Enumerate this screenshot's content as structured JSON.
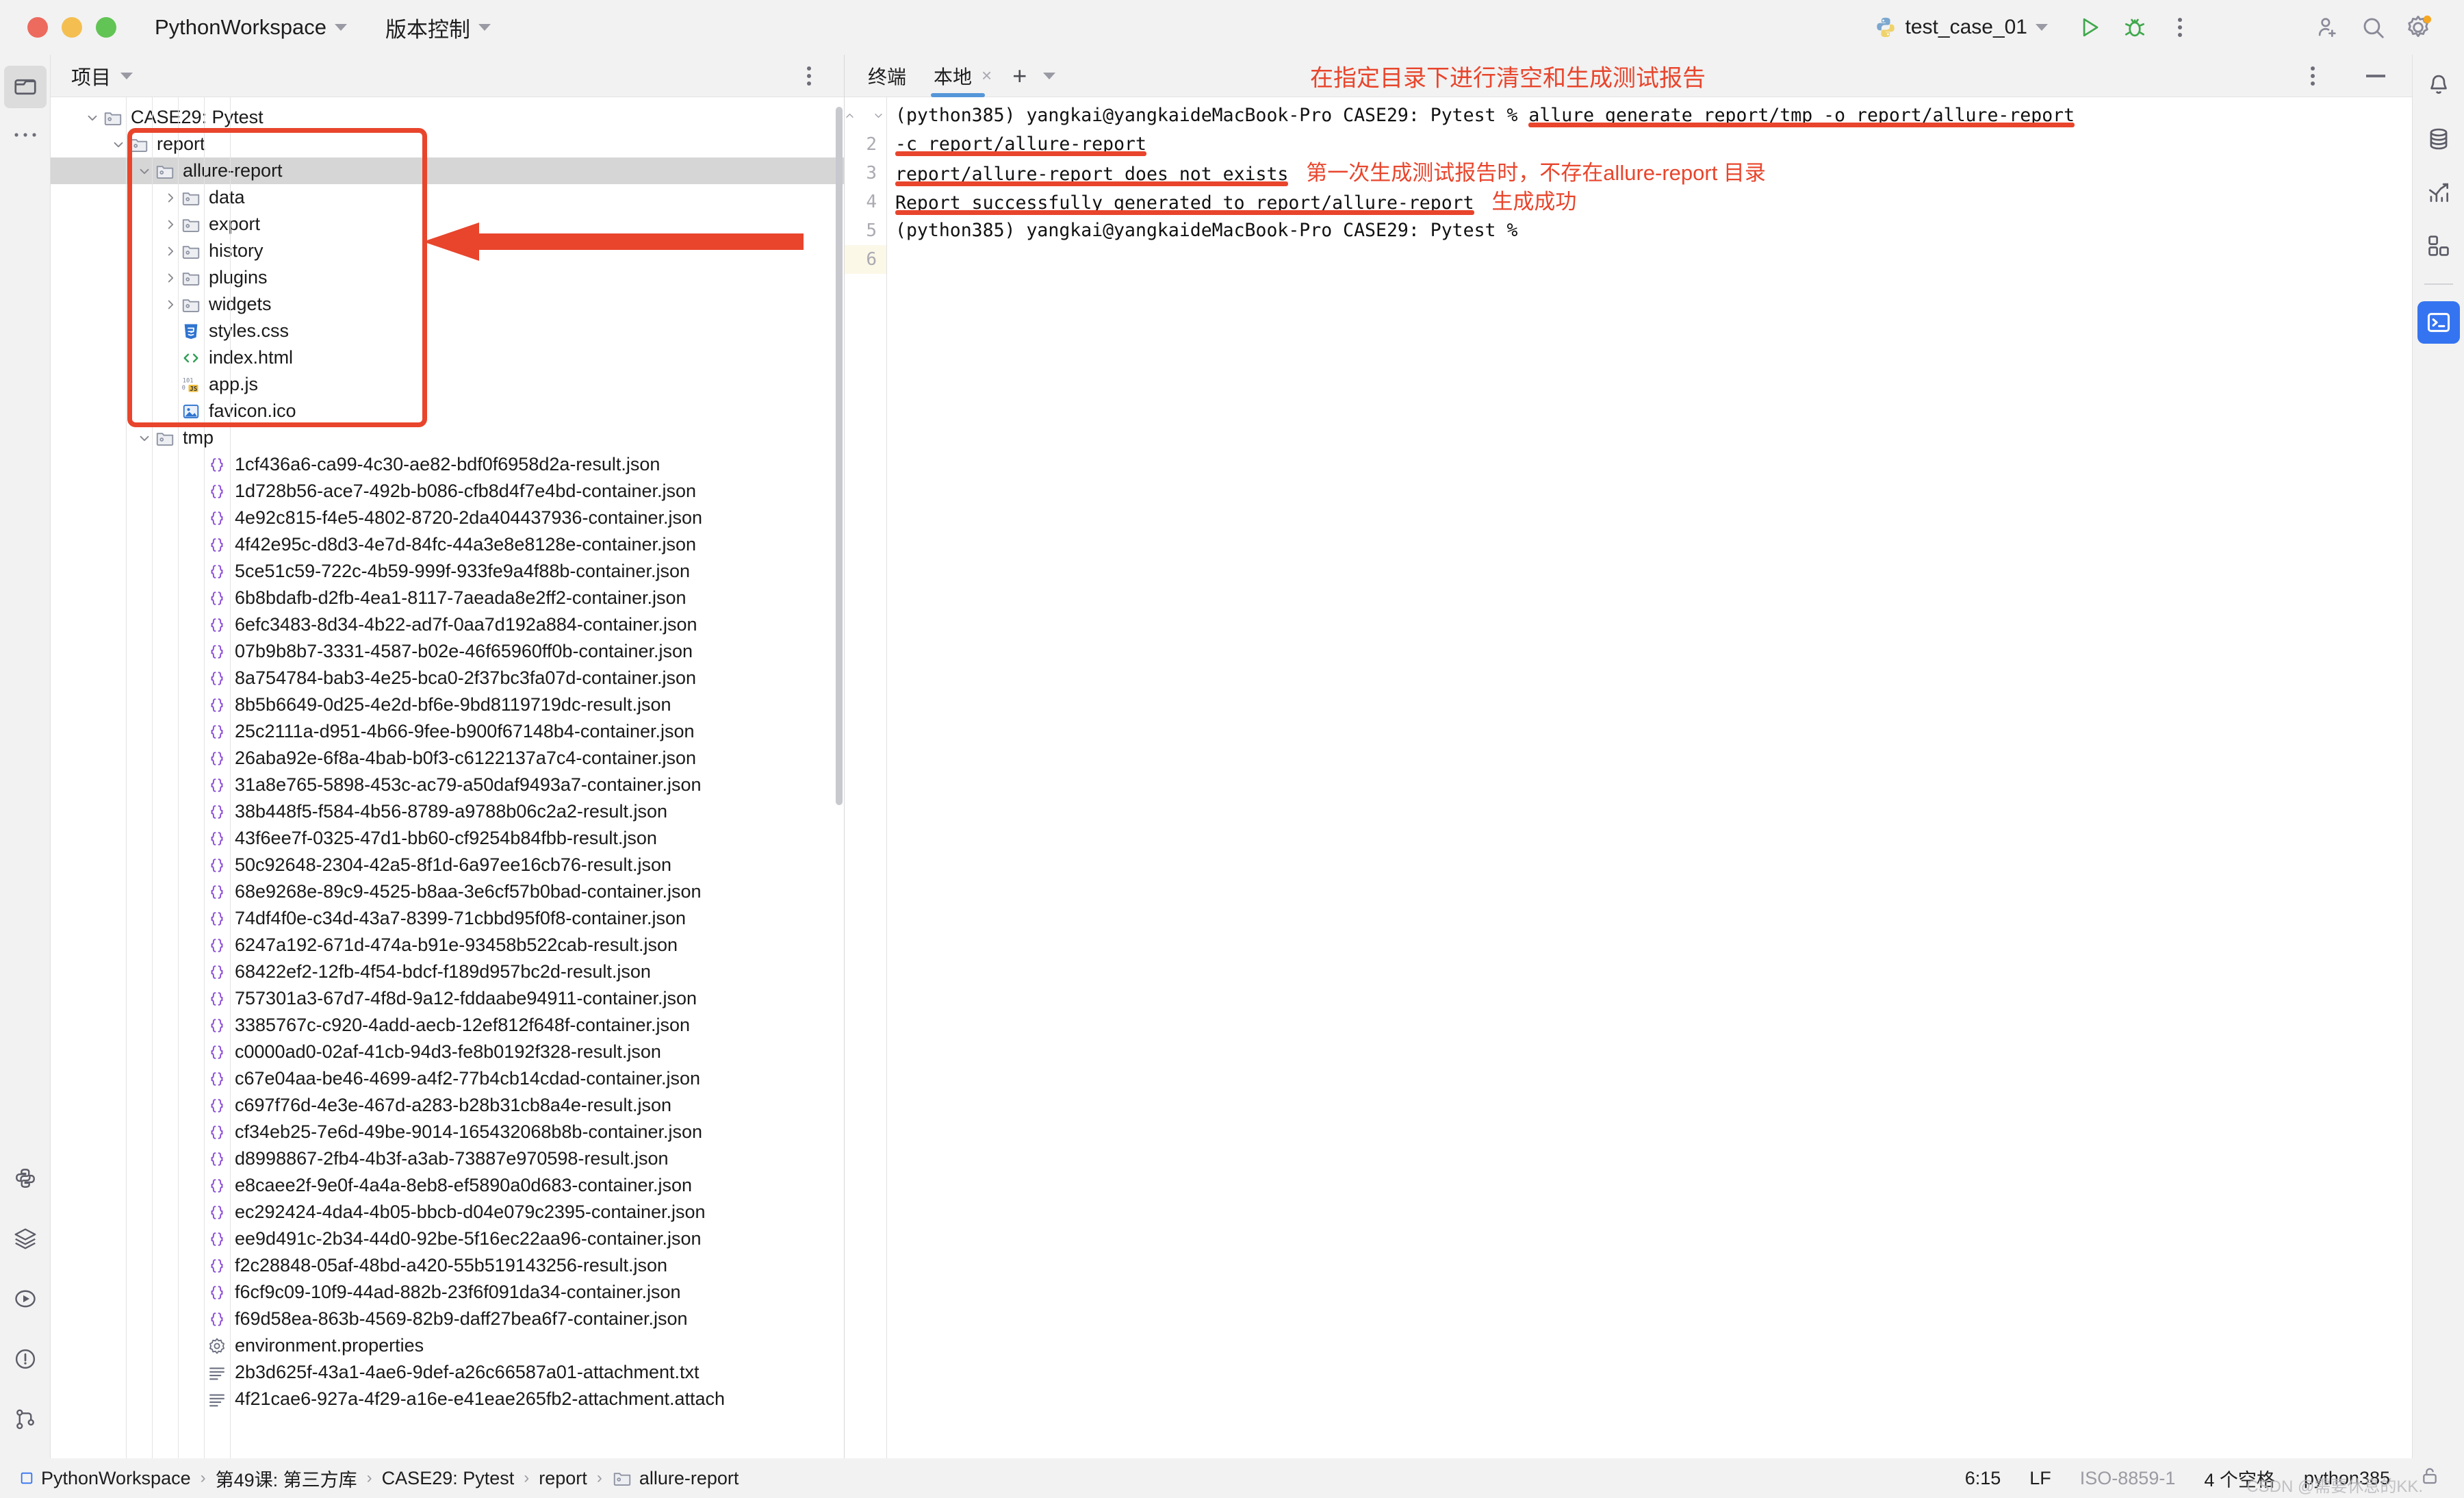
{
  "window": {
    "project_name": "PythonWorkspace",
    "vcs_label": "版本控制",
    "run_config": "test_case_01"
  },
  "project_panel": {
    "title": "项目",
    "tree": [
      {
        "label": "CASE29: Pytest",
        "indent": 0,
        "icon": "folder-module",
        "state": "expanded",
        "selected": false
      },
      {
        "label": "report",
        "indent": 1,
        "icon": "folder-module",
        "state": "expanded",
        "selected": false
      },
      {
        "label": "allure-report",
        "indent": 2,
        "icon": "folder-module",
        "state": "expanded",
        "selected": true
      },
      {
        "label": "data",
        "indent": 3,
        "icon": "folder-module",
        "state": "collapsed",
        "selected": false
      },
      {
        "label": "export",
        "indent": 3,
        "icon": "folder-module",
        "state": "collapsed",
        "selected": false
      },
      {
        "label": "history",
        "indent": 3,
        "icon": "folder-module",
        "state": "collapsed",
        "selected": false
      },
      {
        "label": "plugins",
        "indent": 3,
        "icon": "folder-module",
        "state": "collapsed",
        "selected": false
      },
      {
        "label": "widgets",
        "indent": 3,
        "icon": "folder-module",
        "state": "collapsed",
        "selected": false
      },
      {
        "label": "styles.css",
        "indent": 3,
        "icon": "css-icon",
        "state": "leaf",
        "selected": false
      },
      {
        "label": "index.html",
        "indent": 3,
        "icon": "html-icon",
        "state": "leaf",
        "selected": false
      },
      {
        "label": "app.js",
        "indent": 3,
        "icon": "js-icon",
        "state": "leaf",
        "selected": false
      },
      {
        "label": "favicon.ico",
        "indent": 3,
        "icon": "image-icon",
        "state": "leaf",
        "selected": false
      },
      {
        "label": "tmp",
        "indent": 2,
        "icon": "folder-module",
        "state": "expanded",
        "selected": false
      },
      {
        "label": "1cf436a6-ca99-4c30-ae82-bdf0f6958d2a-result.json",
        "indent": 4,
        "icon": "json-icon",
        "state": "leaf",
        "selected": false
      },
      {
        "label": "1d728b56-ace7-492b-b086-cfb8d4f7e4bd-container.json",
        "indent": 4,
        "icon": "json-icon",
        "state": "leaf",
        "selected": false
      },
      {
        "label": "4e92c815-f4e5-4802-8720-2da404437936-container.json",
        "indent": 4,
        "icon": "json-icon",
        "state": "leaf",
        "selected": false
      },
      {
        "label": "4f42e95c-d8d3-4e7d-84fc-44a3e8e8128e-container.json",
        "indent": 4,
        "icon": "json-icon",
        "state": "leaf",
        "selected": false
      },
      {
        "label": "5ce51c59-722c-4b59-999f-933fe9a4f88b-container.json",
        "indent": 4,
        "icon": "json-icon",
        "state": "leaf",
        "selected": false
      },
      {
        "label": "6b8bdafb-d2fb-4ea1-8117-7aeada8e2ff2-container.json",
        "indent": 4,
        "icon": "json-icon",
        "state": "leaf",
        "selected": false
      },
      {
        "label": "6efc3483-8d34-4b22-ad7f-0aa7d192a884-container.json",
        "indent": 4,
        "icon": "json-icon",
        "state": "leaf",
        "selected": false
      },
      {
        "label": "07b9b8b7-3331-4587-b02e-46f65960ff0b-container.json",
        "indent": 4,
        "icon": "json-icon",
        "state": "leaf",
        "selected": false
      },
      {
        "label": "8a754784-bab3-4e25-bca0-2f37bc3fa07d-container.json",
        "indent": 4,
        "icon": "json-icon",
        "state": "leaf",
        "selected": false
      },
      {
        "label": "8b5b6649-0d25-4e2d-bf6e-9bd8119719dc-result.json",
        "indent": 4,
        "icon": "json-icon",
        "state": "leaf",
        "selected": false
      },
      {
        "label": "25c2111a-d951-4b66-9fee-b900f67148b4-container.json",
        "indent": 4,
        "icon": "json-icon",
        "state": "leaf",
        "selected": false
      },
      {
        "label": "26aba92e-6f8a-4bab-b0f3-c6122137a7c4-container.json",
        "indent": 4,
        "icon": "json-icon",
        "state": "leaf",
        "selected": false
      },
      {
        "label": "31a8e765-5898-453c-ac79-a50daf9493a7-container.json",
        "indent": 4,
        "icon": "json-icon",
        "state": "leaf",
        "selected": false
      },
      {
        "label": "38b448f5-f584-4b56-8789-a9788b06c2a2-result.json",
        "indent": 4,
        "icon": "json-icon",
        "state": "leaf",
        "selected": false
      },
      {
        "label": "43f6ee7f-0325-47d1-bb60-cf9254b84fbb-result.json",
        "indent": 4,
        "icon": "json-icon",
        "state": "leaf",
        "selected": false
      },
      {
        "label": "50c92648-2304-42a5-8f1d-6a97ee16cb76-result.json",
        "indent": 4,
        "icon": "json-icon",
        "state": "leaf",
        "selected": false
      },
      {
        "label": "68e9268e-89c9-4525-b8aa-3e6cf57b0bad-container.json",
        "indent": 4,
        "icon": "json-icon",
        "state": "leaf",
        "selected": false
      },
      {
        "label": "74df4f0e-c34d-43a7-8399-71cbbd95f0f8-container.json",
        "indent": 4,
        "icon": "json-icon",
        "state": "leaf",
        "selected": false
      },
      {
        "label": "6247a192-671d-474a-b91e-93458b522cab-result.json",
        "indent": 4,
        "icon": "json-icon",
        "state": "leaf",
        "selected": false
      },
      {
        "label": "68422ef2-12fb-4f54-bdcf-f189d957bc2d-result.json",
        "indent": 4,
        "icon": "json-icon",
        "state": "leaf",
        "selected": false
      },
      {
        "label": "757301a3-67d7-4f8d-9a12-fddaabe94911-container.json",
        "indent": 4,
        "icon": "json-icon",
        "state": "leaf",
        "selected": false
      },
      {
        "label": "3385767c-c920-4add-aecb-12ef812f648f-container.json",
        "indent": 4,
        "icon": "json-icon",
        "state": "leaf",
        "selected": false
      },
      {
        "label": "c0000ad0-02af-41cb-94d3-fe8b0192f328-result.json",
        "indent": 4,
        "icon": "json-icon",
        "state": "leaf",
        "selected": false
      },
      {
        "label": "c67e04aa-be46-4699-a4f2-77b4cb14cdad-container.json",
        "indent": 4,
        "icon": "json-icon",
        "state": "leaf",
        "selected": false
      },
      {
        "label": "c697f76d-4e3e-467d-a283-b28b31cb8a4e-result.json",
        "indent": 4,
        "icon": "json-icon",
        "state": "leaf",
        "selected": false
      },
      {
        "label": "cf34eb25-7e6d-49be-9014-165432068b8b-container.json",
        "indent": 4,
        "icon": "json-icon",
        "state": "leaf",
        "selected": false
      },
      {
        "label": "d8998867-2fb4-4b3f-a3ab-73887e970598-result.json",
        "indent": 4,
        "icon": "json-icon",
        "state": "leaf",
        "selected": false
      },
      {
        "label": "e8caee2f-9e0f-4a4a-8eb8-ef5890a0d683-container.json",
        "indent": 4,
        "icon": "json-icon",
        "state": "leaf",
        "selected": false
      },
      {
        "label": "ec292424-4da4-4b05-bbcb-d04e079c2395-container.json",
        "indent": 4,
        "icon": "json-icon",
        "state": "leaf",
        "selected": false
      },
      {
        "label": "ee9d491c-2b34-44d0-92be-5f16ec22aa96-container.json",
        "indent": 4,
        "icon": "json-icon",
        "state": "leaf",
        "selected": false
      },
      {
        "label": "f2c28848-05af-48bd-a420-55b519143256-result.json",
        "indent": 4,
        "icon": "json-icon",
        "state": "leaf",
        "selected": false
      },
      {
        "label": "f6cf9c09-10f9-44ad-882b-23f6f091da34-container.json",
        "indent": 4,
        "icon": "json-icon",
        "state": "leaf",
        "selected": false
      },
      {
        "label": "f69d58ea-863b-4569-82b9-daff27bea6f7-container.json",
        "indent": 4,
        "icon": "json-icon",
        "state": "leaf",
        "selected": false
      },
      {
        "label": "environment.properties",
        "indent": 4,
        "icon": "properties-icon",
        "state": "leaf",
        "selected": false
      },
      {
        "label": "2b3d625f-43a1-4ae6-9def-a26c66587a01-attachment.txt",
        "indent": 4,
        "icon": "text-icon",
        "state": "leaf",
        "selected": false
      },
      {
        "label": "4f21cae6-927a-4f29-a16e-e41eae265fb2-attachment.attach",
        "indent": 4,
        "icon": "text-icon",
        "state": "leaf",
        "selected": false
      }
    ]
  },
  "terminal": {
    "label": "终端",
    "tab": "本地",
    "close_label": "×",
    "plus_label": "+",
    "annotation_top": "在指定目录下进行清空和生成测试报告",
    "line_numbers": [
      "2",
      "3",
      "4",
      "5",
      "6"
    ],
    "lines": [
      {
        "segments": [
          {
            "text": "(python385) yangkai@yangkaideMacBook-Pro CASE29: Pytest % ",
            "underline": false,
            "style": "mono"
          },
          {
            "text": "allure generate report/tmp -o report/allure-report",
            "underline": true,
            "style": "mono"
          }
        ]
      },
      {
        "segments": [
          {
            "text": "-c report/allure-report",
            "underline": true,
            "style": "mono"
          }
        ]
      },
      {
        "segments": [
          {
            "text": "report/allure-report does not exists",
            "underline": true,
            "style": "mono"
          },
          {
            "text": "   第一次生成测试报告时，不存在allure-report 目录",
            "underline": false,
            "style": "cn"
          }
        ]
      },
      {
        "segments": [
          {
            "text": "Report successfully generated to report/allure-report",
            "underline": true,
            "style": "mono"
          },
          {
            "text": "   生成成功",
            "underline": false,
            "style": "cn"
          }
        ]
      },
      {
        "segments": [
          {
            "text": "(python385) yangkai@yangkaideMacBook-Pro CASE29: Pytest %",
            "underline": false,
            "style": "mono"
          }
        ]
      }
    ]
  },
  "status_bar": {
    "breadcrumbs": [
      "PythonWorkspace",
      "第49课: 第三方库",
      "CASE29: Pytest",
      "report",
      "allure-report"
    ],
    "separator": "›",
    "caret_position": "6:15",
    "line_separator": "LF",
    "encoding": "ISO-8859-1",
    "indent": "4 个空格",
    "interpreter": "python385",
    "watermark": "CSDN @需要休息的KK."
  },
  "colors": {
    "annotation_red": "#e8452c",
    "accent_blue": "#3574f0",
    "tab_underline": "#5596d8",
    "selection_gray": "#d6d6d6"
  },
  "left_rail": {
    "items": [
      {
        "name": "project-icon",
        "active": true
      },
      {
        "name": "more-icon",
        "active": false
      }
    ],
    "bottom_items": [
      {
        "name": "python-packages-icon"
      },
      {
        "name": "services-icon"
      },
      {
        "name": "run-icon"
      },
      {
        "name": "problems-icon"
      },
      {
        "name": "version-control-icon"
      }
    ]
  },
  "right_rail": {
    "items": [
      {
        "name": "notifications-icon",
        "active": false
      },
      {
        "name": "database-icon",
        "active": false
      },
      {
        "name": "analytics-icon",
        "active": false
      },
      {
        "name": "plugins-icon",
        "active": false
      },
      {
        "name": "terminal-icon",
        "active": true
      }
    ]
  }
}
